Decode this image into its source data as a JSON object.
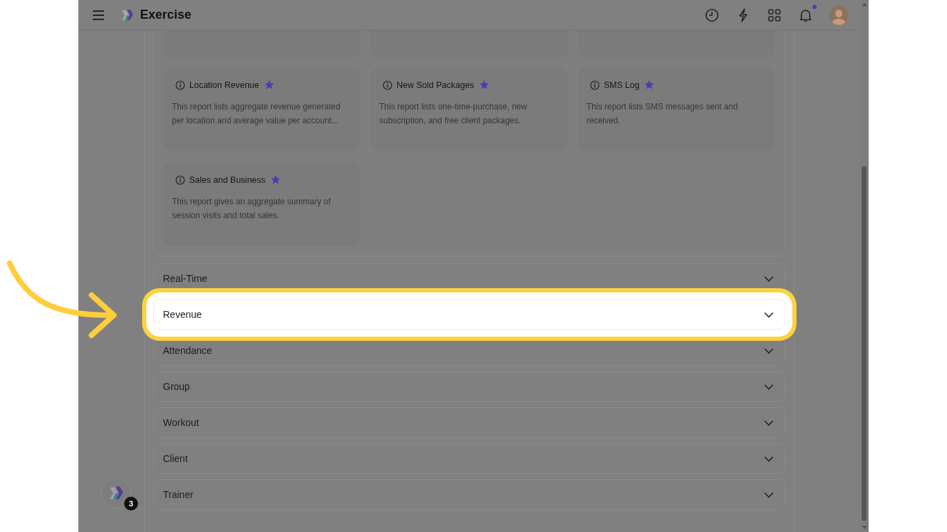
{
  "header": {
    "title": "Exercise",
    "notification_dot": true
  },
  "report_cards": [
    {
      "title": "Location Revenue",
      "description": "This report lists aggregate revenue generated per location and average value per account...",
      "starred": true
    },
    {
      "title": "New Sold Packages",
      "description": "This report lists one-time-purchase, new subscription, and free client packages.",
      "starred": true
    },
    {
      "title": "SMS Log",
      "description": "This report lists SMS messages sent and received.",
      "starred": true
    },
    {
      "title": "Sales and Business",
      "description": "This report gives an aggregate summary of session visits and total sales.",
      "starred": true
    }
  ],
  "sections": [
    {
      "label": "Real-Time",
      "expanded": false,
      "highlighted": false
    },
    {
      "label": "Revenue",
      "expanded": false,
      "highlighted": true
    },
    {
      "label": "Attendance",
      "expanded": false,
      "highlighted": false
    },
    {
      "label": "Group",
      "expanded": false,
      "highlighted": false
    },
    {
      "label": "Workout",
      "expanded": false,
      "highlighted": false
    },
    {
      "label": "Client",
      "expanded": false,
      "highlighted": false
    },
    {
      "label": "Trainer",
      "expanded": false,
      "highlighted": false
    }
  ],
  "launcher": {
    "badge": "3"
  }
}
